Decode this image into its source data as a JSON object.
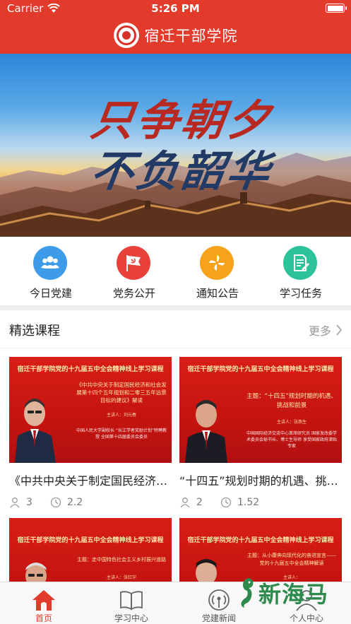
{
  "status_bar": {
    "carrier": "Carrier",
    "time": "5:26 PM"
  },
  "header": {
    "title": "宿迁干部学院"
  },
  "banner": {
    "line1": "只争朝夕",
    "line2": "不负韶华"
  },
  "quick_nav": [
    {
      "label": "今日党建",
      "icon": "people-icon",
      "color": "#3d9be9"
    },
    {
      "label": "党务公开",
      "icon": "party-flag-icon",
      "color": "#e8413a"
    },
    {
      "label": "通知公告",
      "icon": "pinwheel-icon",
      "color": "#f7a21b"
    },
    {
      "label": "学习任务",
      "icon": "document-edit-icon",
      "color": "#2cc39a"
    }
  ],
  "section": {
    "title": "精选课程",
    "more": "更多"
  },
  "courses": [
    {
      "banner_title": "宿迁干部学院党的十九届五中全会精神线上学习课程",
      "subject": "《中共中央关于制定国民经济和社会发展第十四个五年规划和二零三五年远景目标的建议》解读",
      "speaker": "主讲人：刘元春",
      "info": "中国人民大学副校长 “长江学者奖励计划”特聘教授 全国第十四届委员会委员",
      "title": "《中共中央关于制定国民经济和社会发展第十四个五年规划和二〇三五年远景目标的建议》解读",
      "learners": "3",
      "hours": "2.2"
    },
    {
      "banner_title": "宿迁干部学院党的十九届五中全会精神线上学习课程",
      "subject": "主题：“十四五”规划时期的机遇、挑战和前景",
      "speaker": "主讲人：张燕生",
      "info": "中国国际经济交流中心首席研究员 国家发改委学术委员会秘书长、博士生导师 享受国家政府津贴专家",
      "title": "“十四五”规划时期的机遇、挑战和前景",
      "learners": "2",
      "hours": "1.52"
    },
    {
      "banner_title": "宿迁干部学院党的十九届五中全会精神线上学习课程",
      "subject": "主题：走中国特色社会主义乡村振兴道路",
      "speaker": "主讲人：张红宇"
    },
    {
      "banner_title": "宿迁干部学院党的十九届五中全会精神线上学习课程",
      "subject": "主题：从小康奔向现代化的奋进宣言——党的十九届五中全会精神解读",
      "speaker": "主讲人："
    }
  ],
  "tabbar": [
    {
      "label": "首页",
      "icon": "home-icon",
      "active": true
    },
    {
      "label": "学习中心",
      "icon": "book-icon",
      "active": false
    },
    {
      "label": "党建新闻",
      "icon": "broadcast-icon",
      "active": false
    },
    {
      "label": "个人中心",
      "icon": "person-icon",
      "active": false
    }
  ],
  "watermark": {
    "text": "新海马"
  }
}
